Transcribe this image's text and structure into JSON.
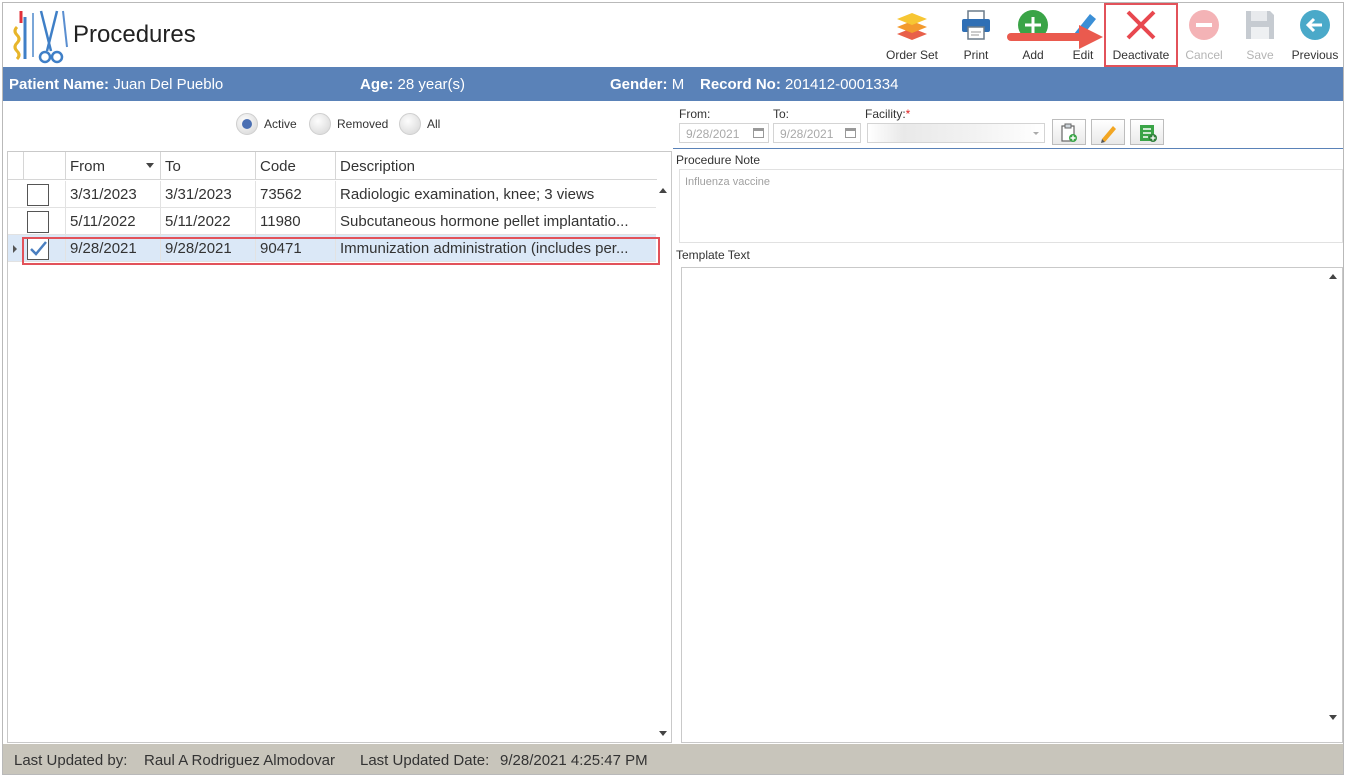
{
  "header": {
    "title": "Procedures",
    "toolbar": [
      {
        "id": "order-set",
        "label": "Order Set",
        "icon": "layers-icon",
        "enabled": true
      },
      {
        "id": "print",
        "label": "Print",
        "icon": "printer-icon",
        "enabled": true
      },
      {
        "id": "add",
        "label": "Add",
        "icon": "plus-circle-icon",
        "enabled": true
      },
      {
        "id": "edit",
        "label": "Edit",
        "icon": "pencil-icon",
        "enabled": true
      },
      {
        "id": "deactivate",
        "label": "Deactivate",
        "icon": "close-x-icon",
        "enabled": true,
        "highlighted": true
      },
      {
        "id": "cancel",
        "label": "Cancel",
        "icon": "minus-circle-icon",
        "enabled": false
      },
      {
        "id": "save",
        "label": "Save",
        "icon": "floppy-disk-icon",
        "enabled": false
      },
      {
        "id": "previous",
        "label": "Previous",
        "icon": "arrow-left-circle-icon",
        "enabled": true
      }
    ]
  },
  "patient": {
    "name_label": "Patient Name:",
    "name": "Juan Del Pueblo",
    "age_label": "Age:",
    "age": "28 year(s)",
    "gender_label": "Gender:",
    "gender": "M",
    "record_label": "Record No:",
    "record": "201412-0001334"
  },
  "filters": {
    "options": [
      "Active",
      "Removed",
      "All"
    ],
    "selected": "Active"
  },
  "grid": {
    "columns": [
      "From",
      "To",
      "Code",
      "Description"
    ],
    "rows": [
      {
        "checked": false,
        "from": "3/31/2023",
        "to": "3/31/2023",
        "code": "73562",
        "description": "Radiologic examination, knee; 3 views"
      },
      {
        "checked": false,
        "from": "5/11/2022",
        "to": "5/11/2022",
        "code": "11980",
        "description": "Subcutaneous hormone pellet implantatio..."
      },
      {
        "checked": true,
        "selected": true,
        "from": "9/28/2021",
        "to": "9/28/2021",
        "code": "90471",
        "description": "Immunization administration (includes per..."
      }
    ]
  },
  "detail": {
    "from_label": "From:",
    "from_value": "9/28/2021",
    "to_label": "To:",
    "to_value": "9/28/2021",
    "facility_label": "Facility:",
    "facility_required": "*",
    "procedure_note_label": "Procedure Note",
    "procedure_note_value": "Influenza vaccine",
    "template_text_label": "Template Text"
  },
  "status_bar": {
    "updated_by_label": "Last Updated by:",
    "updated_by": "Raul A Rodriguez Almodovar",
    "updated_date_label": "Last Updated Date:",
    "updated_date": "9/28/2021 4:25:47 PM"
  },
  "colors": {
    "accent": "#5a82b8",
    "highlight": "#e2525a",
    "selected_row": "#dbe8f7",
    "status_bar": "#c8c5bb"
  }
}
